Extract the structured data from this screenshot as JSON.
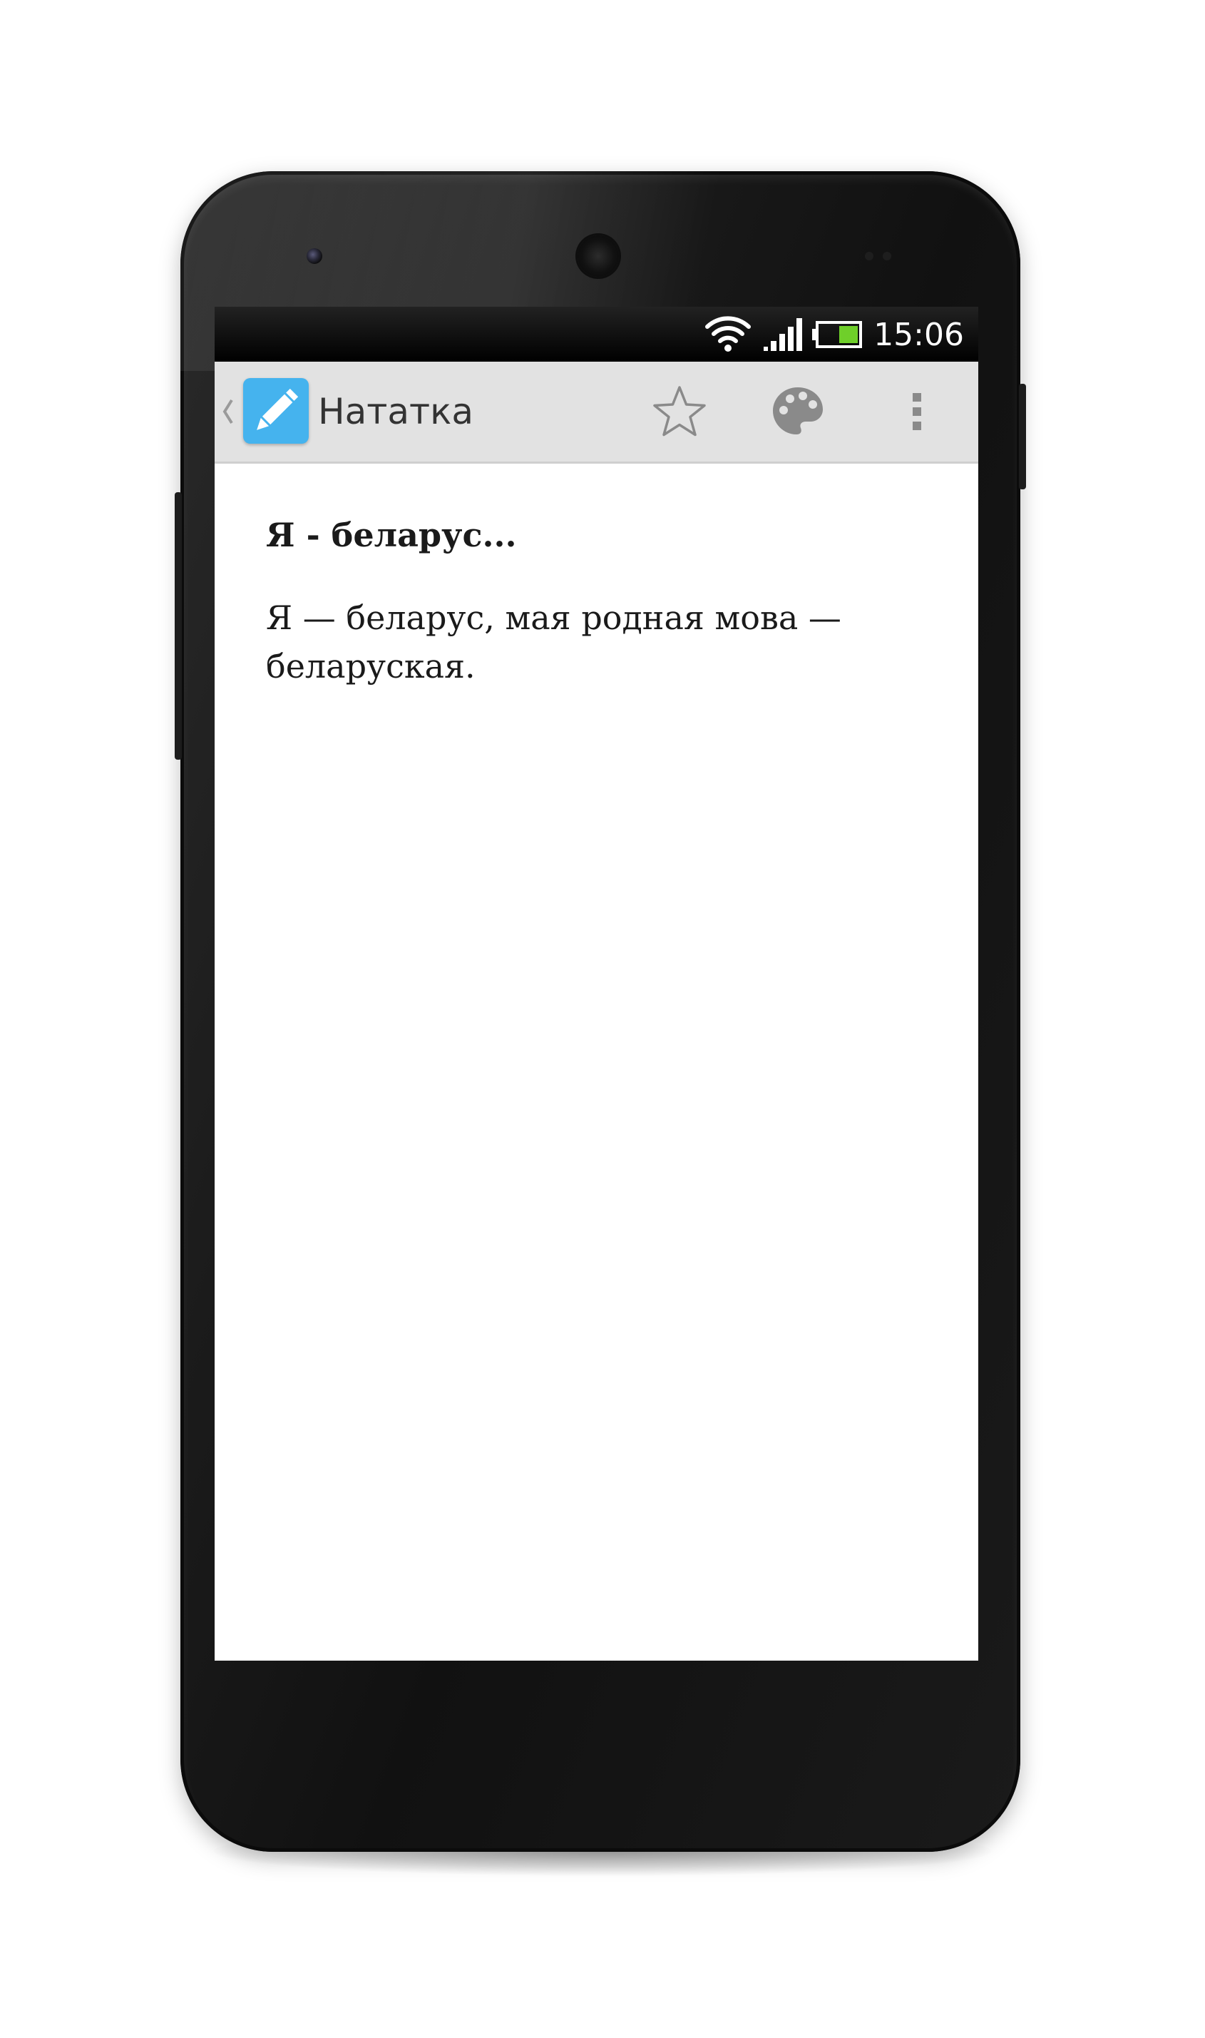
{
  "status_bar": {
    "time": "15:06",
    "icons": [
      "wifi-icon",
      "signal-icon",
      "battery-icon"
    ]
  },
  "action_bar": {
    "title": "Нататка",
    "app_icon": "pencil-icon",
    "actions": [
      "star-icon",
      "palette-icon",
      "overflow-menu-icon"
    ]
  },
  "note": {
    "title": "Я - беларус...",
    "body": "Я — беларус, мая родная мова — беларуская."
  },
  "colors": {
    "action_bar_bg": "#e2e2e2",
    "app_icon_bg": "#45b3ee",
    "battery_level": "#6fcf2a"
  }
}
